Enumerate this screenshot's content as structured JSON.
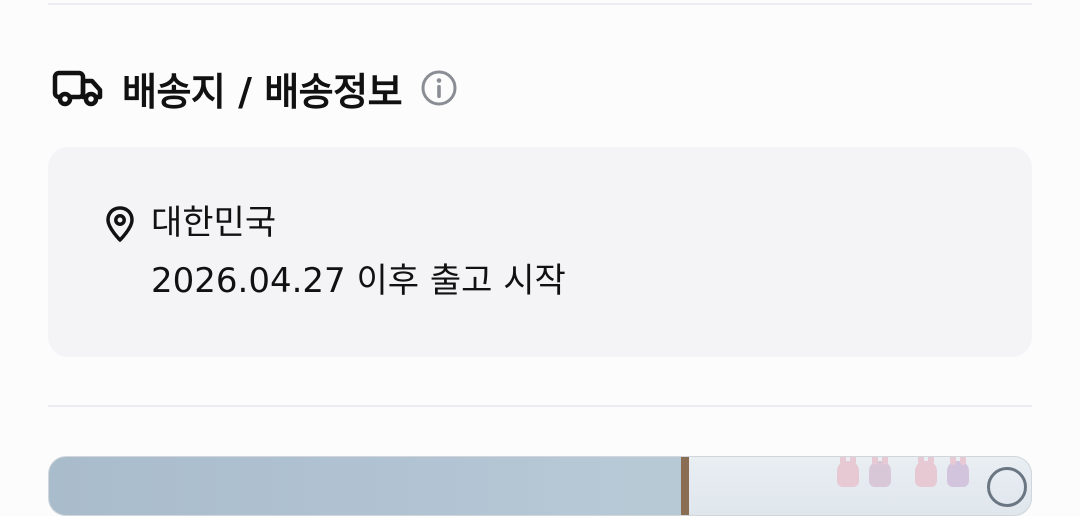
{
  "shipping_section": {
    "title": "배송지 / 배송정보",
    "header_icon": "truck-icon",
    "info_icon": "info-circle-icon",
    "destination": {
      "icon": "location-pin-icon",
      "country": "대한민국",
      "shipping_note": "2026.04.27 이후 출고 시작"
    }
  },
  "product_preview": {
    "image": "product-photo"
  },
  "colors": {
    "background": "#fcfcfd",
    "card_background": "#f4f4f7",
    "divider": "#ececf0",
    "text_primary": "#111111",
    "info_icon": "#8a8d94"
  }
}
